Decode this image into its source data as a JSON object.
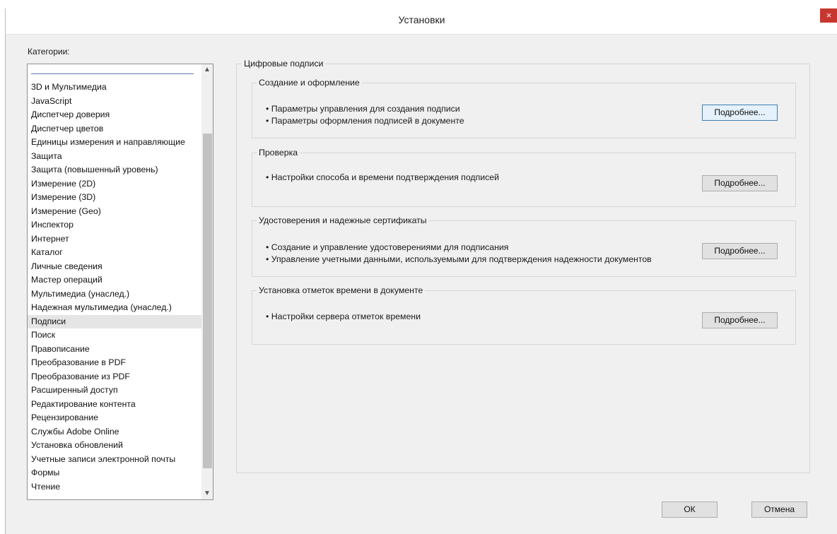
{
  "window": {
    "title": "Установки",
    "close_symbol": "×"
  },
  "categories": {
    "label": "Категории:",
    "items": [
      "3D и Мультимедиа",
      "JavaScript",
      "Диспетчер доверия",
      "Диспетчер цветов",
      "Единицы измерения и направляющие",
      "Защита",
      "Защита (повышенный уровень)",
      "Измерение (2D)",
      "Измерение (3D)",
      "Измерение (Geo)",
      "Инспектор",
      "Интернет",
      "Каталог",
      "Личные сведения",
      "Мастер операций",
      "Мультимедиа (унаслед.)",
      "Надежная мультимедиа (унаслед.)",
      "Подписи",
      "Поиск",
      "Правописание",
      "Преобразование в PDF",
      "Преобразование из PDF",
      "Расширенный доступ",
      "Редактирование контента",
      "Рецензирование",
      "Службы Adobe Online",
      "Установка обновлений",
      "Учетные записи электронной почты",
      "Формы",
      "Чтение"
    ],
    "selected": "Подписи",
    "scroll_up": "▲",
    "scroll_down": "▼"
  },
  "panel": {
    "title": "Цифровые подписи",
    "sections": [
      {
        "title": "Создание и оформление",
        "bullets": [
          "• Параметры управления для создания подписи",
          "• Параметры оформления подписей в документе"
        ],
        "button": "Подробнее..."
      },
      {
        "title": "Проверка",
        "bullets": [
          "• Настройки способа и времени подтверждения подписей"
        ],
        "button": "Подробнее..."
      },
      {
        "title": "Удостоверения и надежные сертификаты",
        "bullets": [
          "• Создание и управление удостоверениями для подписания",
          "• Управление учетными данными, используемыми для подтверждения надежности документов"
        ],
        "button": "Подробнее..."
      },
      {
        "title": "Установка отметок времени в документе",
        "bullets": [
          "• Настройки сервера отметок времени"
        ],
        "button": "Подробнее..."
      }
    ]
  },
  "footer": {
    "ok": "ОК",
    "cancel": "Отмена"
  }
}
